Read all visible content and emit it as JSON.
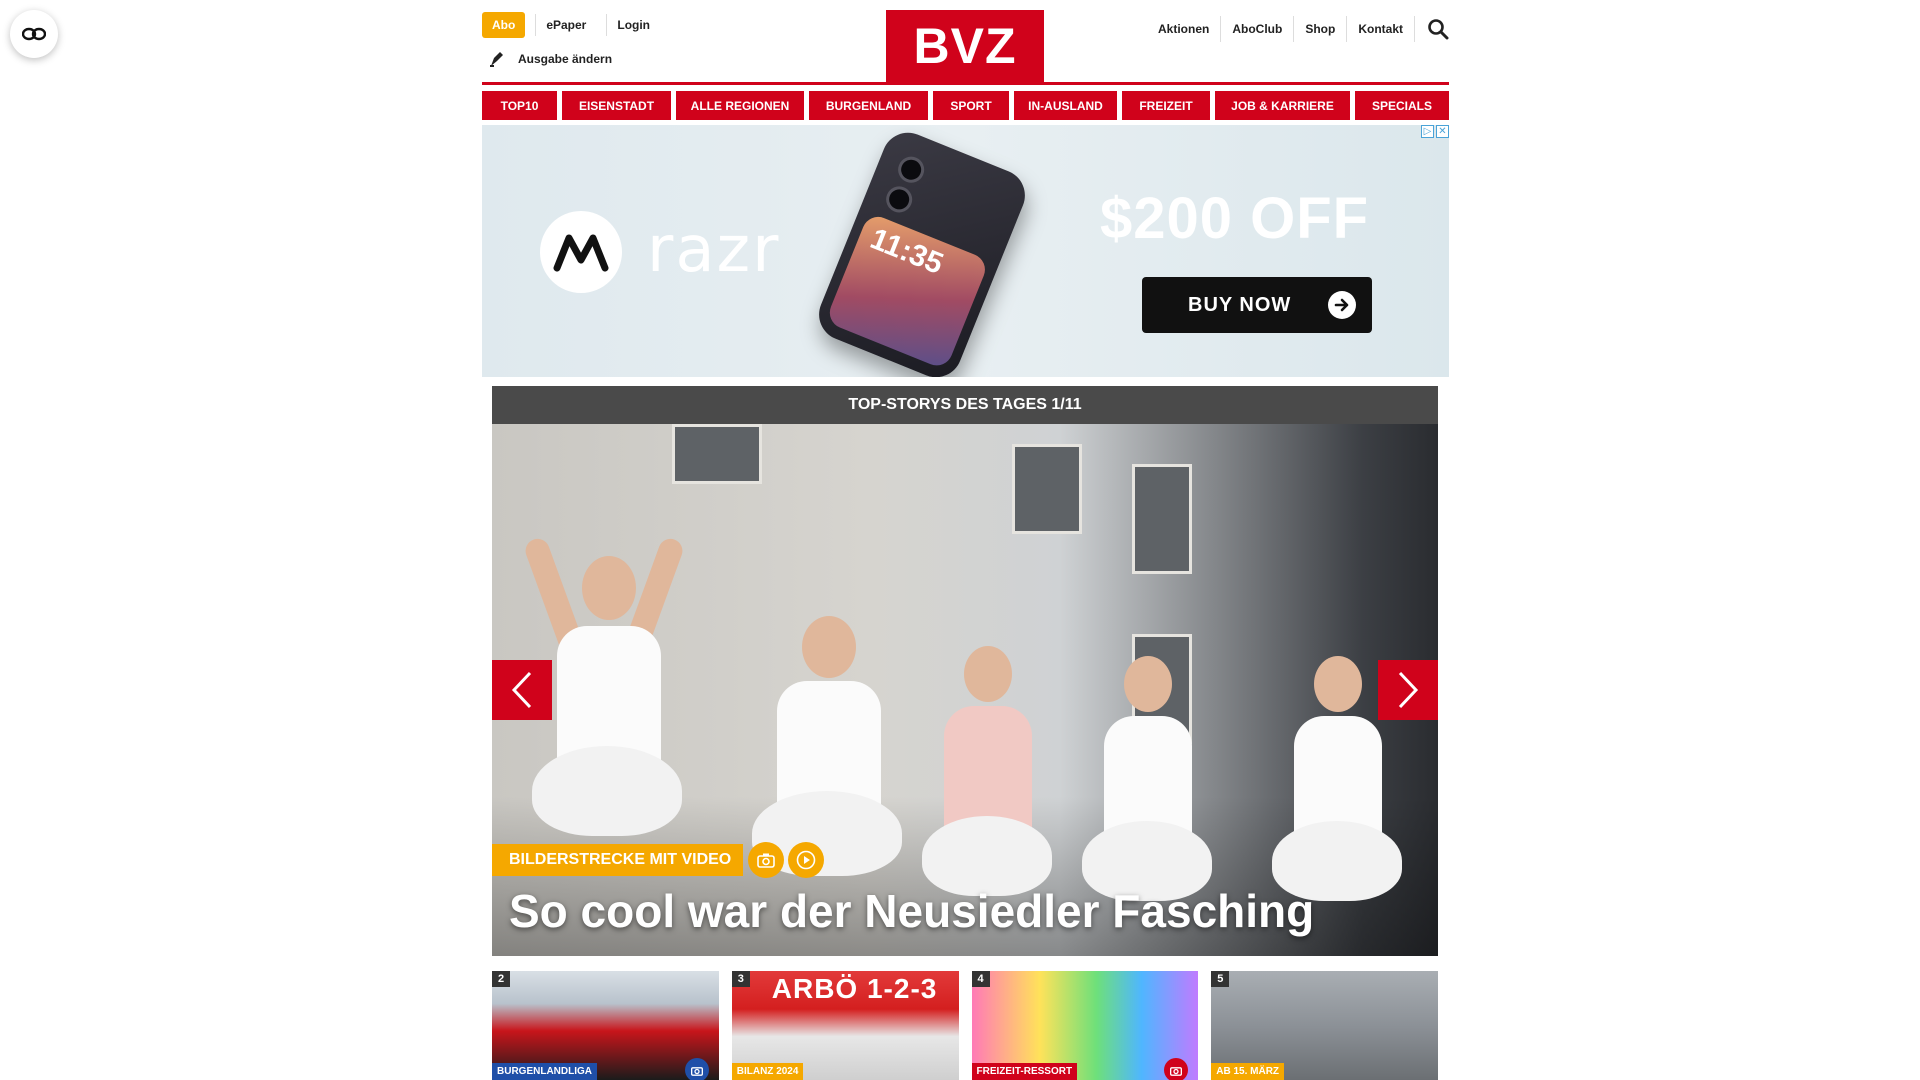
{
  "header": {
    "abo_label": "Abo",
    "epaper_label": "ePaper",
    "login_label": "Login",
    "edition_label": "Ausgabe ändern",
    "logo_text": "BVZ",
    "right_links": [
      "Aktionen",
      "AboClub",
      "Shop",
      "Kontakt"
    ],
    "brand_color": "#d0021b",
    "accent_color": "#f5a800"
  },
  "nav": {
    "items": [
      "TOP10",
      "EISENSTADT",
      "ALLE REGIONEN",
      "BURGENLAND",
      "SPORT",
      "IN-AUSLAND",
      "FREIZEIT",
      "JOB & KARRIERE",
      "SPECIALS"
    ]
  },
  "ad": {
    "brand": "razr",
    "phone_time": "11:35",
    "offer": "$200 OFF",
    "cta": "BUY NOW"
  },
  "top_stories": {
    "bar_title": "TOP-STORYS DES TAGES 1/11",
    "hero": {
      "tag": "BILDERSTRECKE MIT VIDEO",
      "title": "So cool war der Neusiedler Fasching",
      "icons": [
        "camera-icon",
        "play-icon"
      ]
    },
    "teasers": [
      {
        "num": "2",
        "label": "BURGENLANDLIGA",
        "label_color": "#1f4fa8",
        "has_camera": true
      },
      {
        "num": "3",
        "label": "BILANZ 2024",
        "label_color": "#f5a800",
        "brand_text": "ARBÖ 1-2-3",
        "has_camera": false
      },
      {
        "num": "4",
        "label": "FREIZEIT-RESSORT",
        "label_color": "#d0021b",
        "has_camera": true
      },
      {
        "num": "5",
        "label": "AB 15. MÄRZ",
        "label_color": "#f5a800",
        "has_camera": false
      }
    ]
  }
}
